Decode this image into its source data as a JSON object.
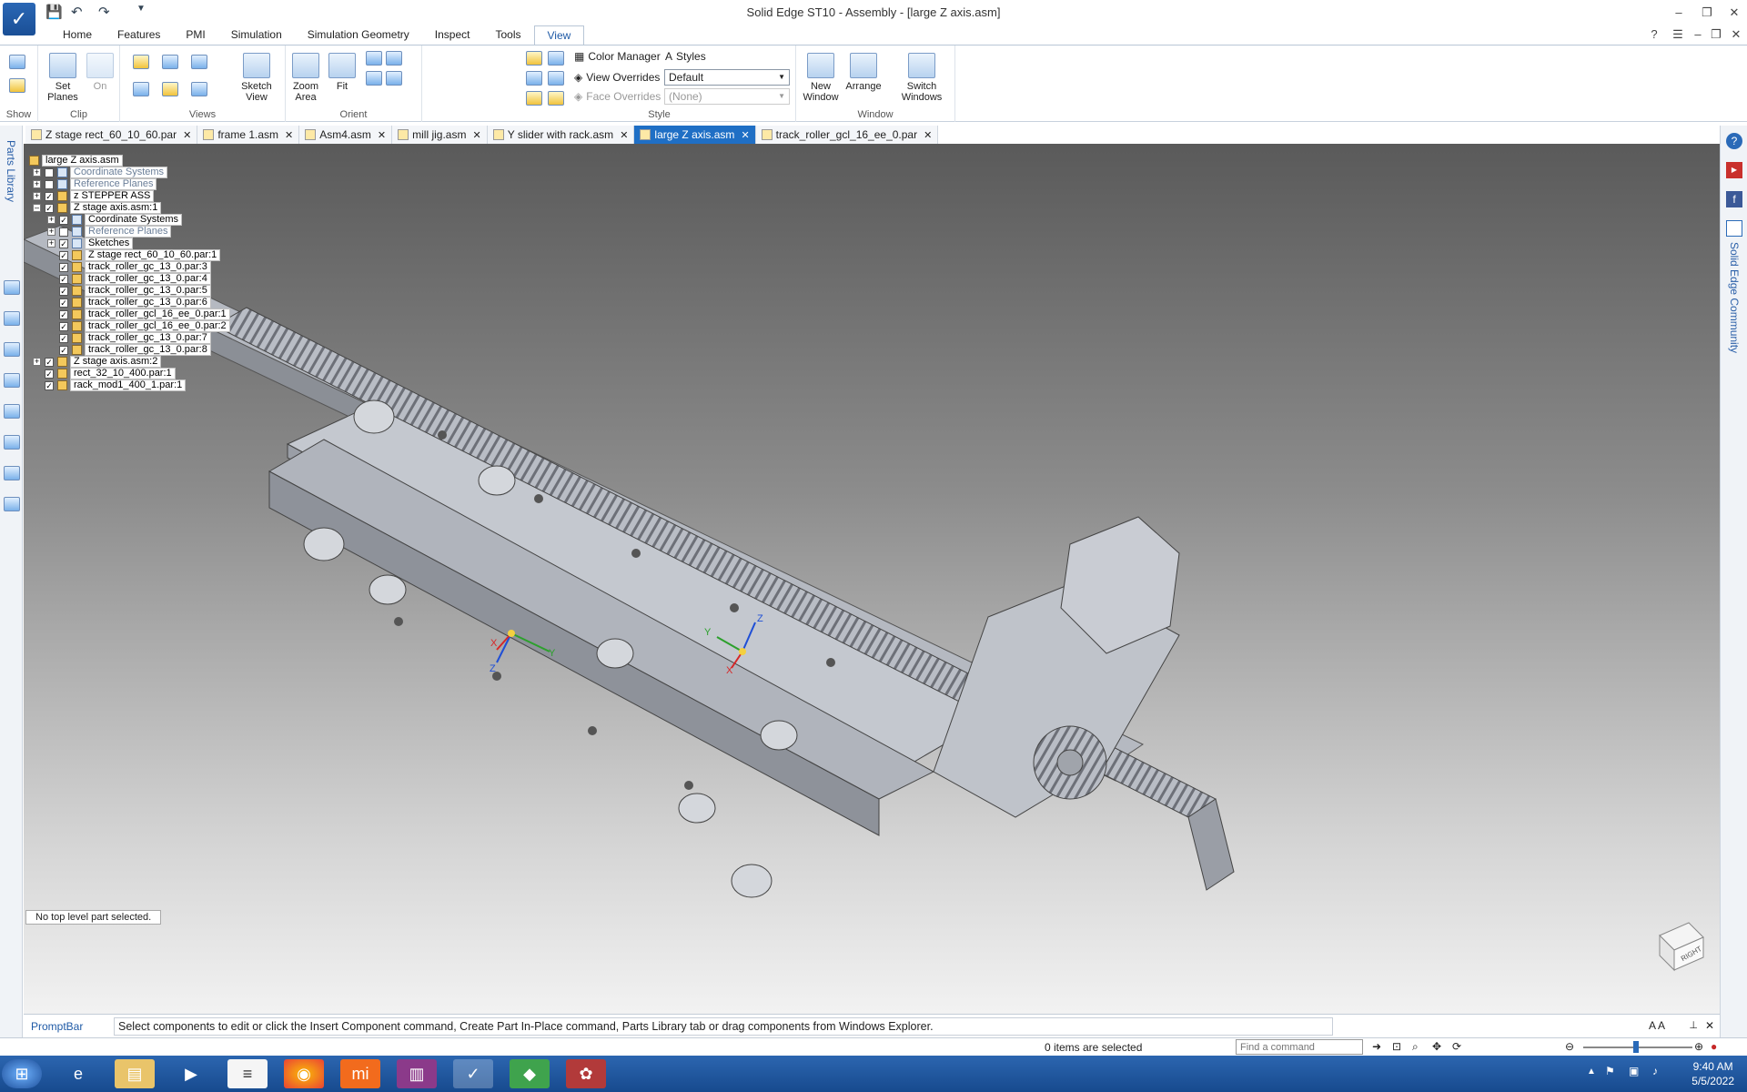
{
  "window": {
    "title": "Solid Edge ST10 - Assembly - [large Z  axis.asm]"
  },
  "ribbon_tabs": [
    "Home",
    "Features",
    "PMI",
    "Simulation",
    "Simulation Geometry",
    "Inspect",
    "Tools",
    "View"
  ],
  "ribbon": {
    "show": {
      "label": "Show"
    },
    "clip": {
      "label": "Clip",
      "set_planes": "Set Planes",
      "on": "On"
    },
    "views": {
      "label": "Views",
      "sketch_view": "Sketch View"
    },
    "orient": {
      "label": "Orient",
      "zoom_area": "Zoom Area",
      "fit": "Fit"
    },
    "style": {
      "label": "Style",
      "color_manager": "Color Manager",
      "styles": "Styles",
      "view_overrides": "View Overrides",
      "view_overrides_value": "Default",
      "face_overrides": "Face Overrides",
      "face_overrides_value": "(None)"
    },
    "window": {
      "label": "Window",
      "new_window": "New Window",
      "arrange": "Arrange",
      "switch_windows": "Switch Windows"
    }
  },
  "doc_tabs": [
    "Z stage rect_60_10_60.par",
    "frame 1.asm",
    "Asm4.asm",
    "mill jig.asm",
    "Y slider with rack.asm",
    "large Z  axis.asm",
    "track_roller_gcl_16_ee_0.par"
  ],
  "left_panel": {
    "parts_library": "Parts Library"
  },
  "right_panel": {
    "community": "Solid Edge Community"
  },
  "tree": [
    {
      "label": "large Z  axis.asm"
    },
    {
      "label": "Coordinate Systems"
    },
    {
      "label": "Reference Planes"
    },
    {
      "label": "z STEPPER ASS"
    },
    {
      "label": "Z stage axis.asm:1"
    },
    {
      "label": "Coordinate Systems"
    },
    {
      "label": "Reference Planes"
    },
    {
      "label": "Sketches"
    },
    {
      "label": "Z stage rect_60_10_60.par:1"
    },
    {
      "label": "track_roller_gc_13_0.par:3"
    },
    {
      "label": "track_roller_gc_13_0.par:4"
    },
    {
      "label": "track_roller_gc_13_0.par:5"
    },
    {
      "label": "track_roller_gc_13_0.par:6"
    },
    {
      "label": "track_roller_gcl_16_ee_0.par:1"
    },
    {
      "label": "track_roller_gcl_16_ee_0.par:2"
    },
    {
      "label": "track_roller_gc_13_0.par:7"
    },
    {
      "label": "track_roller_gc_13_0.par:8"
    },
    {
      "label": "Z stage axis.asm:2"
    },
    {
      "label": "rect_32_10_400.par:1"
    },
    {
      "label": "rack_mod1_400_1.par:1"
    }
  ],
  "viewport": {
    "status": "No top level part selected.",
    "cube_face": "RIGHT",
    "axis_x": "X",
    "axis_y": "Y",
    "axis_z": "Z"
  },
  "promptbar": {
    "label": "PromptBar",
    "text": "Select components to edit or click the Insert Component command, Create Part In-Place command, Parts Library tab or drag components from Windows Explorer."
  },
  "statusbar": {
    "items_selected": "0 items are selected",
    "find_placeholder": "Find a command"
  },
  "taskbar": {
    "time": "9:40 AM",
    "date": "5/5/2022"
  }
}
